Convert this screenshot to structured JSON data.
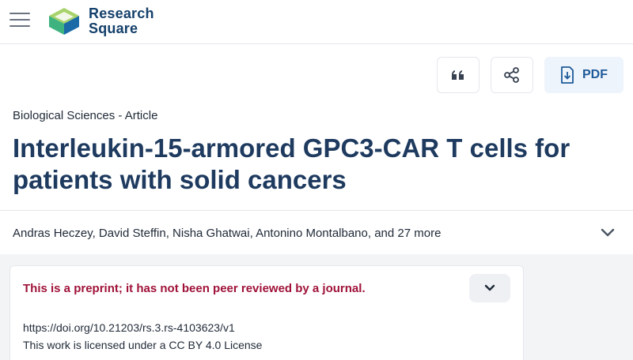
{
  "header": {
    "logo_line1": "Research",
    "logo_line2": "Square",
    "logo_colors": {
      "green": "#3fb37f",
      "blue": "#1a6aa8",
      "lime": "#a8d26a",
      "text": "#14406b"
    }
  },
  "toolbar": {
    "cite_icon": "quote-icon",
    "share_icon": "share-icon",
    "pdf_icon": "download-icon",
    "pdf_label": "PDF"
  },
  "article": {
    "category": "Biological Sciences - Article",
    "title": "Interleukin-15-armored GPC3-CAR T cells for patients with solid cancers",
    "authors": "Andras Heczey, David Steffin, Nisha Ghatwai, Antonino Montalbano, and 27 more"
  },
  "notice": {
    "text": "This is a preprint; it has not been peer reviewed by a journal.",
    "doi": "https://doi.org/10.21203/rs.3.rs-4103623/v1",
    "license": "This work is licensed under a CC BY 4.0 License"
  },
  "colors": {
    "title": "#1e3a5f",
    "preprint_warning": "#9f1239",
    "pdf_button_bg": "#eef4fb",
    "pdf_button_text": "#1e5a99"
  }
}
